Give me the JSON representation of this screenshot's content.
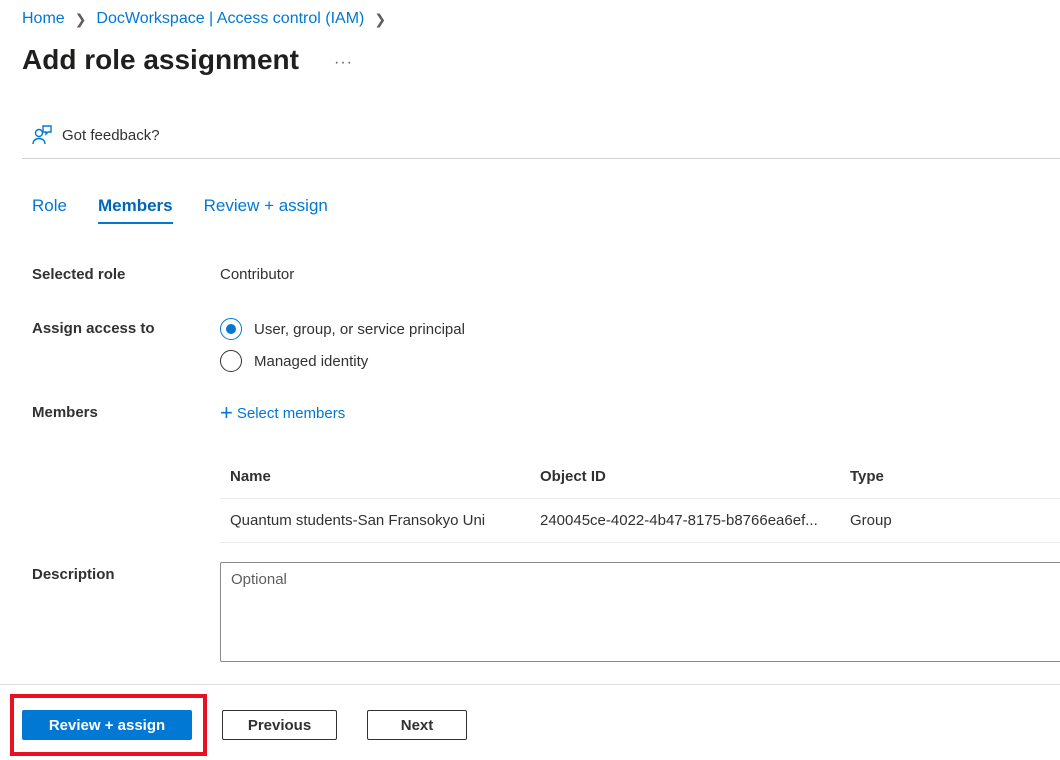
{
  "breadcrumb": [
    {
      "label": "Home"
    },
    {
      "label": "DocWorkspace | Access control (IAM)"
    }
  ],
  "page": {
    "title": "Add role assignment",
    "more_label": "···"
  },
  "feedback": {
    "label": "Got feedback?",
    "icon": "feedback-person-icon"
  },
  "tabs": [
    {
      "label": "Role",
      "active": false
    },
    {
      "label": "Members",
      "active": true
    },
    {
      "label": "Review + assign",
      "active": false
    }
  ],
  "form": {
    "selected_role": {
      "label": "Selected role",
      "value": "Contributor"
    },
    "assign_access_to": {
      "label": "Assign access to",
      "options": [
        {
          "label": "User, group, or service principal",
          "checked": true
        },
        {
          "label": "Managed identity",
          "checked": false
        }
      ]
    },
    "members": {
      "label": "Members",
      "select_label": "Select members",
      "columns": [
        "Name",
        "Object ID",
        "Type"
      ],
      "rows": [
        {
          "name": "Quantum students-San Fransokyo Uni",
          "object_id": "240045ce-4022-4b47-8175-b8766ea6ef...",
          "type": "Group"
        }
      ]
    },
    "description": {
      "label": "Description",
      "value": "",
      "placeholder": "Optional"
    }
  },
  "footer": {
    "review_assign_label": "Review + assign",
    "previous_label": "Previous",
    "next_label": "Next"
  },
  "colors": {
    "accent": "#0078d4",
    "highlight": "#e81123"
  }
}
